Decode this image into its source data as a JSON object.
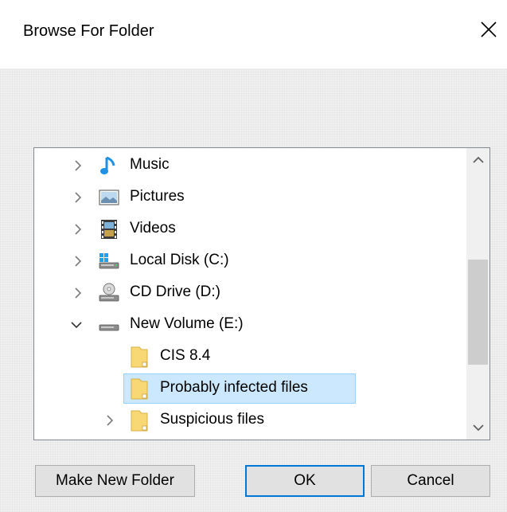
{
  "dialog": {
    "title": "Browse For Folder",
    "close_glyph": "✕"
  },
  "tree": {
    "items": [
      {
        "label": "Music",
        "icon": "music-icon",
        "expanded": false,
        "has_children": true
      },
      {
        "label": "Pictures",
        "icon": "pictures-icon",
        "expanded": false,
        "has_children": true
      },
      {
        "label": "Videos",
        "icon": "videos-icon",
        "expanded": false,
        "has_children": true
      },
      {
        "label": "Local Disk (C:)",
        "icon": "local-disk-icon",
        "expanded": false,
        "has_children": true
      },
      {
        "label": "CD Drive (D:)",
        "icon": "cd-drive-icon",
        "expanded": false,
        "has_children": true
      },
      {
        "label": "New Volume (E:)",
        "icon": "drive-icon",
        "expanded": true,
        "has_children": true
      },
      {
        "label": "CIS 8.4",
        "icon": "folder-icon",
        "expanded": false,
        "has_children": false
      },
      {
        "label": "Probably infected files",
        "icon": "folder-icon",
        "expanded": false,
        "has_children": false,
        "selected": true
      },
      {
        "label": "Suspicious files",
        "icon": "folder-icon",
        "expanded": false,
        "has_children": true
      }
    ]
  },
  "buttons": {
    "make_new_folder": "Make New Folder",
    "ok": "OK",
    "cancel": "Cancel"
  },
  "colors": {
    "selection": "#cce8ff",
    "accent": "#0078d7"
  }
}
